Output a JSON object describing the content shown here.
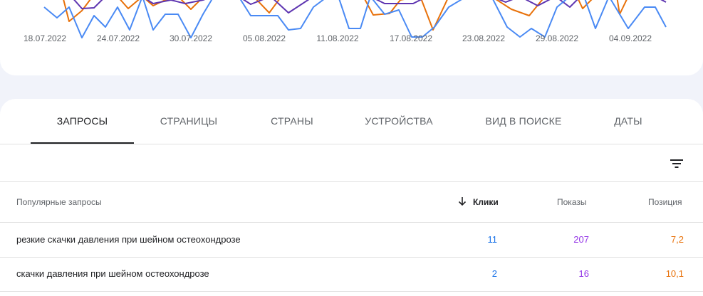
{
  "chart": {
    "x_ticks": [
      "18.07.2022",
      "24.07.2022",
      "30.07.2022",
      "05.08.2022",
      "11.08.2022",
      "17.08.2022",
      "23.08.2022",
      "29.08.2022",
      "04.09.2022"
    ],
    "colors": {
      "clicks": "#4a8af4",
      "impressions": "#5e35b1",
      "position": "#e8710a"
    }
  },
  "tabs": [
    "ЗАПРОСЫ",
    "СТРАНИЦЫ",
    "СТРАНЫ",
    "УСТРОЙСТВА",
    "ВИД В ПОИСКЕ",
    "ДАТЫ"
  ],
  "table": {
    "headers": {
      "query": "Популярные запросы",
      "clicks": "Клики",
      "impressions": "Показы",
      "position": "Позиция"
    },
    "rows": [
      {
        "query": "резкие скачки давления при шейном остеохондрозе",
        "clicks": "11",
        "impressions": "207",
        "position": "7,2"
      },
      {
        "query": "скачки давления при шейном остеохондрозе",
        "clicks": "2",
        "impressions": "16",
        "position": "10,1"
      }
    ],
    "colors": {
      "clicks": "#1a73e8",
      "impressions": "#9334e6",
      "position": "#e8710a"
    }
  },
  "icons": {
    "filter": "filter-icon",
    "sort": "arrow-down-icon"
  }
}
